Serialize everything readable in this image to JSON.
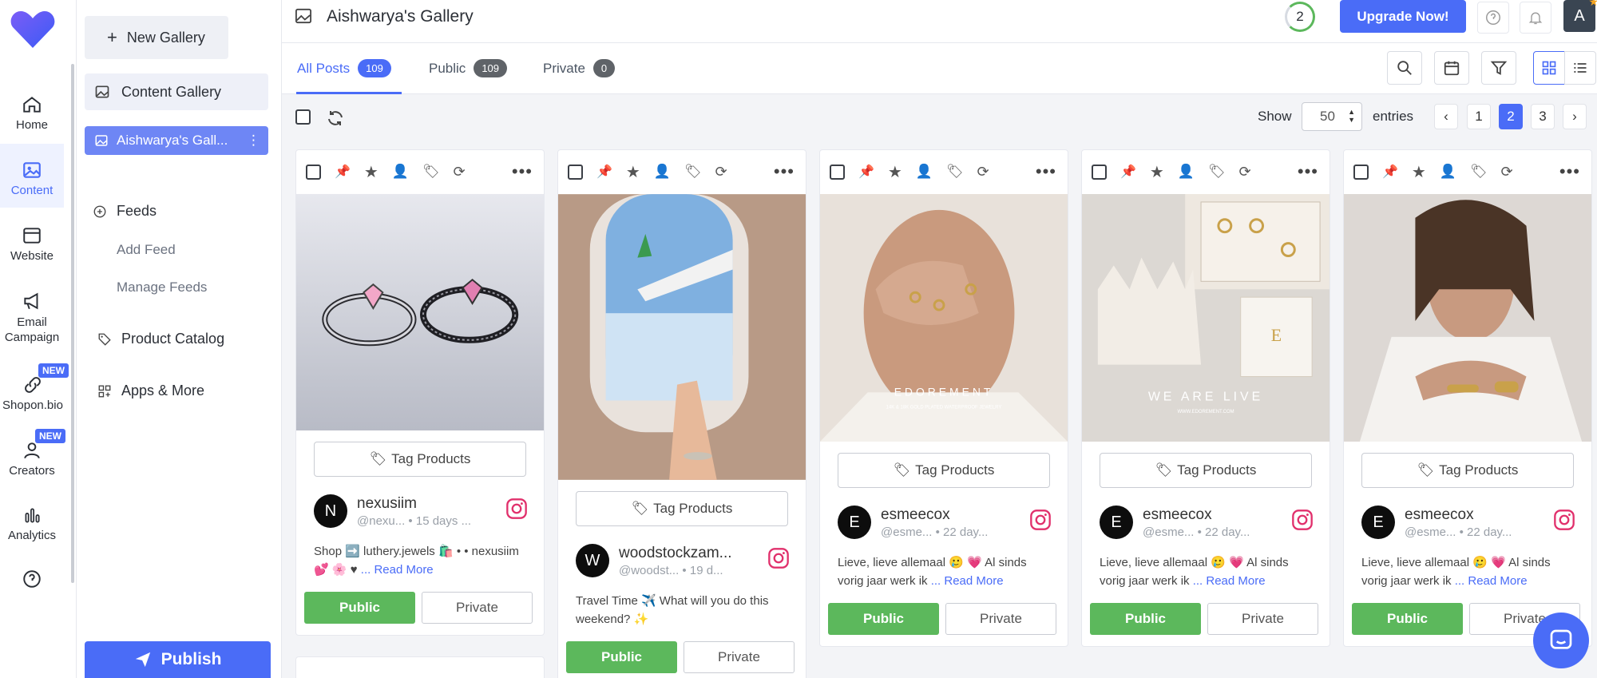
{
  "app": {
    "gallery_title": "Aishwarya's Gallery"
  },
  "rail": {
    "items": [
      {
        "label": "Home"
      },
      {
        "label": "Content"
      },
      {
        "label": "Website"
      },
      {
        "label": "Email Campaign"
      },
      {
        "label": "Shopon.bio",
        "badge": "NEW"
      },
      {
        "label": "Creators",
        "badge": "NEW"
      },
      {
        "label": "Analytics"
      }
    ]
  },
  "sidebar": {
    "new_gallery": "New Gallery",
    "content_gallery": "Content Gallery",
    "selected_gallery": "Aishwarya's Gall...",
    "feeds": "Feeds",
    "add_feed": "Add Feed",
    "manage_feeds": "Manage Feeds",
    "product_catalog": "Product Catalog",
    "apps_more": "Apps & More",
    "publish": "Publish"
  },
  "topbar": {
    "counter": "2",
    "upgrade": "Upgrade Now!",
    "avatar": "A"
  },
  "tabs": [
    {
      "label": "All Posts",
      "count": "109"
    },
    {
      "label": "Public",
      "count": "109"
    },
    {
      "label": "Private",
      "count": "0"
    }
  ],
  "controls": {
    "show": "Show",
    "entries_value": "50",
    "entries": "entries",
    "pages": [
      "1",
      "2",
      "3"
    ],
    "current_page": "2"
  },
  "posts": [
    {
      "tag": "Tag Products",
      "avatar": "N",
      "name": "nexusiim",
      "handle": "@nexu...",
      "age": "15 days ...",
      "caption": "Shop ➡️ luthery.jewels 🛍️ • • nexusiim 💕 🌸 ♥",
      "read_more": "... Read More",
      "public": "Public",
      "private": "Private"
    },
    {
      "tag": "Tag Products",
      "avatar": "W",
      "name": "woodstockzam...",
      "handle": "@woodst...",
      "age": "19 d...",
      "caption": "Travel Time ✈️ What will you do this weekend? ✨",
      "read_more": "",
      "public": "Public",
      "private": "Private"
    },
    {
      "tag": "Tag Products",
      "avatar": "E",
      "name": "esmeecox",
      "handle": "@esme...",
      "age": "22 day...",
      "caption": "Lieve, lieve allemaal 🥲 💗 Al sinds vorig jaar werk ik",
      "read_more": "... Read More",
      "public": "Public",
      "private": "Private"
    },
    {
      "tag": "Tag Products",
      "avatar": "E",
      "name": "esmeecox",
      "handle": "@esme...",
      "age": "22 day...",
      "caption": "Lieve, lieve allemaal 🥲 💗 Al sinds vorig jaar werk ik",
      "read_more": "... Read More",
      "public": "Public",
      "private": "Private"
    },
    {
      "tag": "Tag Products",
      "avatar": "E",
      "name": "esmeecox",
      "handle": "@esme...",
      "age": "22 day...",
      "caption": "Lieve, lieve allemaal 🥲 💗 Al sinds vorig jaar werk ik",
      "read_more": "... Read More",
      "public": "Public",
      "private": "Private"
    }
  ],
  "image_text": {
    "brand_3": "EDOREMENT",
    "brand_3_sub": "14K & 18K GOLD PLATED WATERPROOF JEWELRY",
    "brand_4": "WE ARE LIVE",
    "brand_4_sub": "WWW.EDOREMENT.COM"
  },
  "colors": {
    "accent": "#4a6cf7",
    "public": "#5cb85c"
  }
}
